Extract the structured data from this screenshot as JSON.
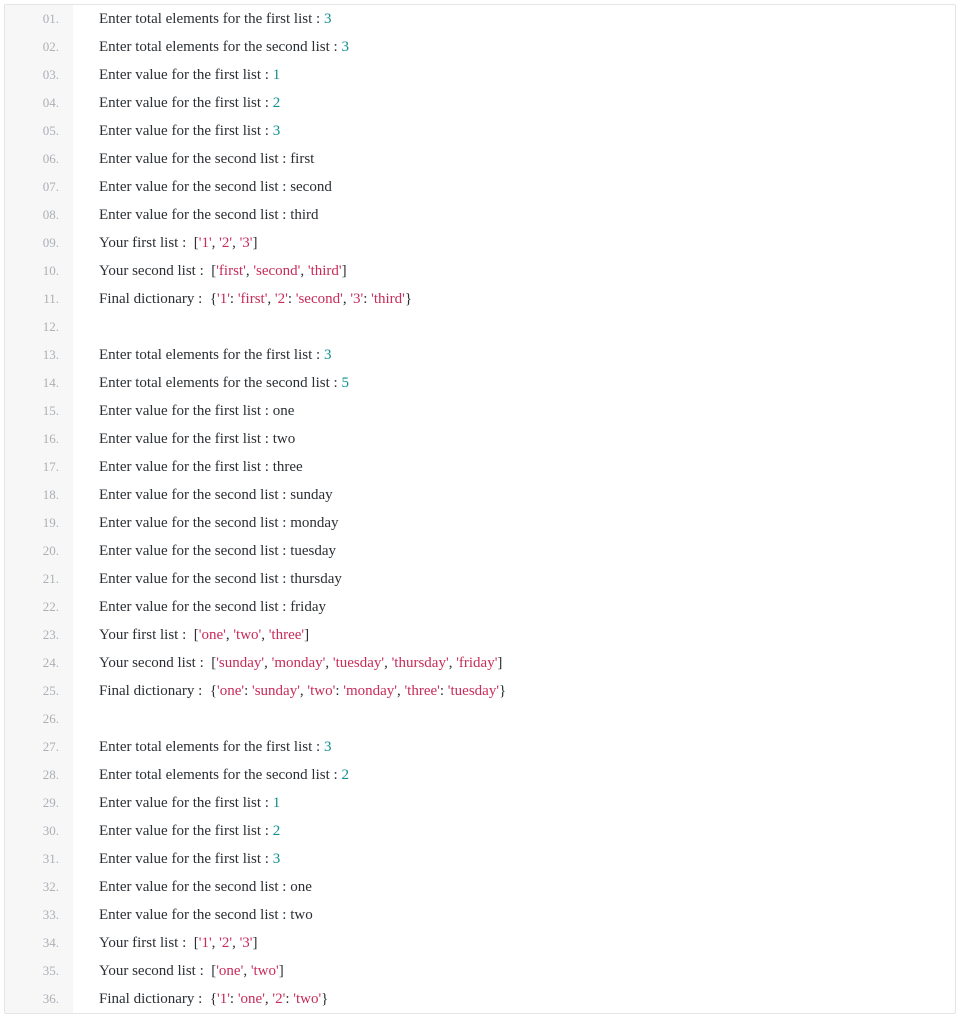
{
  "lines": [
    {
      "n": "01.",
      "tokens": [
        [
          "text",
          "Enter total elements for the first list : "
        ],
        [
          "num",
          "3"
        ]
      ]
    },
    {
      "n": "02.",
      "tokens": [
        [
          "text",
          "Enter total elements for the second list : "
        ],
        [
          "num",
          "3"
        ]
      ]
    },
    {
      "n": "03.",
      "tokens": [
        [
          "text",
          "Enter value for the first list : "
        ],
        [
          "num",
          "1"
        ]
      ]
    },
    {
      "n": "04.",
      "tokens": [
        [
          "text",
          "Enter value for the first list : "
        ],
        [
          "num",
          "2"
        ]
      ]
    },
    {
      "n": "05.",
      "tokens": [
        [
          "text",
          "Enter value for the first list : "
        ],
        [
          "num",
          "3"
        ]
      ]
    },
    {
      "n": "06.",
      "tokens": [
        [
          "text",
          "Enter value for the second list : first"
        ]
      ]
    },
    {
      "n": "07.",
      "tokens": [
        [
          "text",
          "Enter value for the second list : second"
        ]
      ]
    },
    {
      "n": "08.",
      "tokens": [
        [
          "text",
          "Enter value for the second list : third"
        ]
      ]
    },
    {
      "n": "09.",
      "tokens": [
        [
          "text",
          "Your first list :  ["
        ],
        [
          "str",
          "'1'"
        ],
        [
          "text",
          ", "
        ],
        [
          "str",
          "'2'"
        ],
        [
          "text",
          ", "
        ],
        [
          "str",
          "'3'"
        ],
        [
          "text",
          "]"
        ]
      ]
    },
    {
      "n": "10.",
      "tokens": [
        [
          "text",
          "Your second list :  ["
        ],
        [
          "str",
          "'first'"
        ],
        [
          "text",
          ", "
        ],
        [
          "str",
          "'second'"
        ],
        [
          "text",
          ", "
        ],
        [
          "str",
          "'third'"
        ],
        [
          "text",
          "]"
        ]
      ]
    },
    {
      "n": "11.",
      "tokens": [
        [
          "text",
          "Final dictionary :  {"
        ],
        [
          "str",
          "'1'"
        ],
        [
          "text",
          ": "
        ],
        [
          "str",
          "'first'"
        ],
        [
          "text",
          ", "
        ],
        [
          "str",
          "'2'"
        ],
        [
          "text",
          ": "
        ],
        [
          "str",
          "'second'"
        ],
        [
          "text",
          ", "
        ],
        [
          "str",
          "'3'"
        ],
        [
          "text",
          ": "
        ],
        [
          "str",
          "'third'"
        ],
        [
          "text",
          "}"
        ]
      ]
    },
    {
      "n": "12.",
      "tokens": []
    },
    {
      "n": "13.",
      "tokens": [
        [
          "text",
          "Enter total elements for the first list : "
        ],
        [
          "num",
          "3"
        ]
      ]
    },
    {
      "n": "14.",
      "tokens": [
        [
          "text",
          "Enter total elements for the second list : "
        ],
        [
          "num",
          "5"
        ]
      ]
    },
    {
      "n": "15.",
      "tokens": [
        [
          "text",
          "Enter value for the first list : one"
        ]
      ]
    },
    {
      "n": "16.",
      "tokens": [
        [
          "text",
          "Enter value for the first list : two"
        ]
      ]
    },
    {
      "n": "17.",
      "tokens": [
        [
          "text",
          "Enter value for the first list : three"
        ]
      ]
    },
    {
      "n": "18.",
      "tokens": [
        [
          "text",
          "Enter value for the second list : sunday"
        ]
      ]
    },
    {
      "n": "19.",
      "tokens": [
        [
          "text",
          "Enter value for the second list : monday"
        ]
      ]
    },
    {
      "n": "20.",
      "tokens": [
        [
          "text",
          "Enter value for the second list : tuesday"
        ]
      ]
    },
    {
      "n": "21.",
      "tokens": [
        [
          "text",
          "Enter value for the second list : thursday"
        ]
      ]
    },
    {
      "n": "22.",
      "tokens": [
        [
          "text",
          "Enter value for the second list : friday"
        ]
      ]
    },
    {
      "n": "23.",
      "tokens": [
        [
          "text",
          "Your first list :  ["
        ],
        [
          "str",
          "'one'"
        ],
        [
          "text",
          ", "
        ],
        [
          "str",
          "'two'"
        ],
        [
          "text",
          ", "
        ],
        [
          "str",
          "'three'"
        ],
        [
          "text",
          "]"
        ]
      ]
    },
    {
      "n": "24.",
      "tokens": [
        [
          "text",
          "Your second list :  ["
        ],
        [
          "str",
          "'sunday'"
        ],
        [
          "text",
          ", "
        ],
        [
          "str",
          "'monday'"
        ],
        [
          "text",
          ", "
        ],
        [
          "str",
          "'tuesday'"
        ],
        [
          "text",
          ", "
        ],
        [
          "str",
          "'thursday'"
        ],
        [
          "text",
          ", "
        ],
        [
          "str",
          "'friday'"
        ],
        [
          "text",
          "]"
        ]
      ]
    },
    {
      "n": "25.",
      "tokens": [
        [
          "text",
          "Final dictionary :  {"
        ],
        [
          "str",
          "'one'"
        ],
        [
          "text",
          ": "
        ],
        [
          "str",
          "'sunday'"
        ],
        [
          "text",
          ", "
        ],
        [
          "str",
          "'two'"
        ],
        [
          "text",
          ": "
        ],
        [
          "str",
          "'monday'"
        ],
        [
          "text",
          ", "
        ],
        [
          "str",
          "'three'"
        ],
        [
          "text",
          ": "
        ],
        [
          "str",
          "'tuesday'"
        ],
        [
          "text",
          "}"
        ]
      ]
    },
    {
      "n": "26.",
      "tokens": []
    },
    {
      "n": "27.",
      "tokens": [
        [
          "text",
          "Enter total elements for the first list : "
        ],
        [
          "num",
          "3"
        ]
      ]
    },
    {
      "n": "28.",
      "tokens": [
        [
          "text",
          "Enter total elements for the second list : "
        ],
        [
          "num",
          "2"
        ]
      ]
    },
    {
      "n": "29.",
      "tokens": [
        [
          "text",
          "Enter value for the first list : "
        ],
        [
          "num",
          "1"
        ]
      ]
    },
    {
      "n": "30.",
      "tokens": [
        [
          "text",
          "Enter value for the first list : "
        ],
        [
          "num",
          "2"
        ]
      ]
    },
    {
      "n": "31.",
      "tokens": [
        [
          "text",
          "Enter value for the first list : "
        ],
        [
          "num",
          "3"
        ]
      ]
    },
    {
      "n": "32.",
      "tokens": [
        [
          "text",
          "Enter value for the second list : one"
        ]
      ]
    },
    {
      "n": "33.",
      "tokens": [
        [
          "text",
          "Enter value for the second list : two"
        ]
      ]
    },
    {
      "n": "34.",
      "tokens": [
        [
          "text",
          "Your first list :  ["
        ],
        [
          "str",
          "'1'"
        ],
        [
          "text",
          ", "
        ],
        [
          "str",
          "'2'"
        ],
        [
          "text",
          ", "
        ],
        [
          "str",
          "'3'"
        ],
        [
          "text",
          "]"
        ]
      ]
    },
    {
      "n": "35.",
      "tokens": [
        [
          "text",
          "Your second list :  ["
        ],
        [
          "str",
          "'one'"
        ],
        [
          "text",
          ", "
        ],
        [
          "str",
          "'two'"
        ],
        [
          "text",
          "]"
        ]
      ]
    },
    {
      "n": "36.",
      "tokens": [
        [
          "text",
          "Final dictionary :  {"
        ],
        [
          "str",
          "'1'"
        ],
        [
          "text",
          ": "
        ],
        [
          "str",
          "'one'"
        ],
        [
          "text",
          ", "
        ],
        [
          "str",
          "'2'"
        ],
        [
          "text",
          ": "
        ],
        [
          "str",
          "'two'"
        ],
        [
          "text",
          "}"
        ]
      ]
    }
  ]
}
